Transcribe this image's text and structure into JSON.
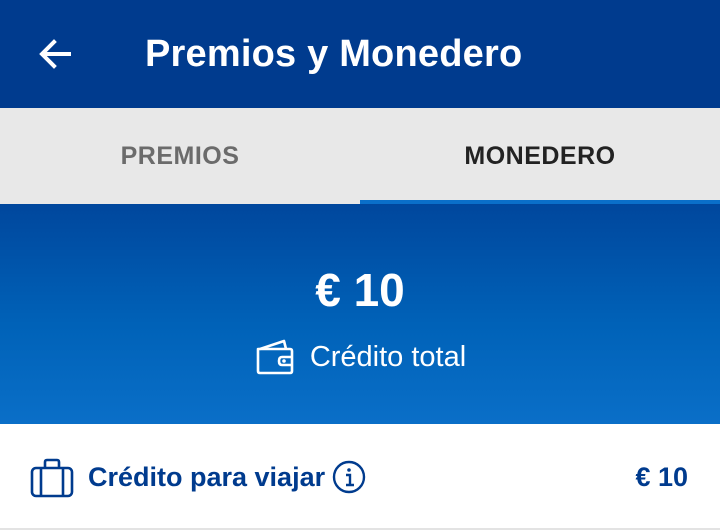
{
  "appbar": {
    "title": "Premios y Monedero",
    "back_icon": "arrow-left-icon",
    "background": "#003b8e"
  },
  "tabs": [
    {
      "label": "PREMIOS",
      "active": false
    },
    {
      "label": "MONEDERO",
      "active": true
    }
  ],
  "hero": {
    "amount": "€ 10",
    "label": "Crédito total",
    "icon": "wallet-icon"
  },
  "rows": [
    {
      "icon": "suitcase-icon",
      "label": "Crédito para viajar",
      "info_icon": "info-icon",
      "value": "€ 10"
    }
  ],
  "colors": {
    "primary": "#003b8e",
    "tab_indicator": "#0a6fc9",
    "tab_background": "#e8e8e8"
  }
}
